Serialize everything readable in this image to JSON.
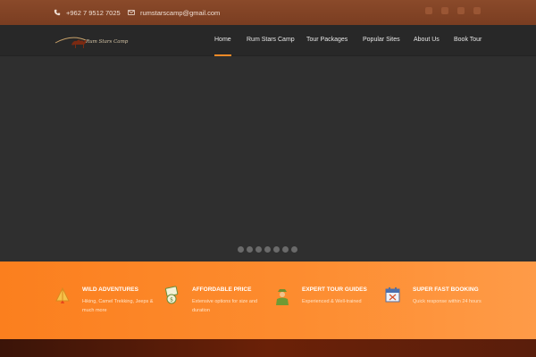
{
  "topbar": {
    "phone": "+962 7 9512 7025",
    "email": "rumstarscamp@gmail.com",
    "socials": [
      "facebook-icon",
      "twitter-icon",
      "instagram-icon",
      "google-plus-icon"
    ]
  },
  "brand": {
    "logo_text": "Rum Stars Camp"
  },
  "nav": {
    "items": [
      {
        "label": "Home",
        "active": true
      },
      {
        "label": "Rum Stars Camp"
      },
      {
        "label": "Tour Packages"
      },
      {
        "label": "Popular Sites"
      },
      {
        "label": "About Us"
      },
      {
        "label": "Book Tour"
      }
    ]
  },
  "slider": {
    "slide_count": 7,
    "active_index": 0
  },
  "features": [
    {
      "icon": "campfire-icon",
      "title": "WILD ADVENTURES",
      "desc": "Hiking, Camel Trekking, Jeeps & much more"
    },
    {
      "icon": "money-icon",
      "title": "AFFORDABLE PRICE",
      "desc": "Extensive options for size and duration"
    },
    {
      "icon": "tour-guide-icon",
      "title": "EXPERT TOUR GUIDES",
      "desc": "Experienced & Well-trained"
    },
    {
      "icon": "calendar-icon",
      "title": "SUPER FAST BOOKING",
      "desc": "Quick response within 24 hours"
    }
  ],
  "colors": {
    "accent": "#f48a27",
    "topbar": "#7a3d21",
    "nav": "#282828",
    "hero": "#2f2f2f",
    "features": "#fd8c2f"
  }
}
